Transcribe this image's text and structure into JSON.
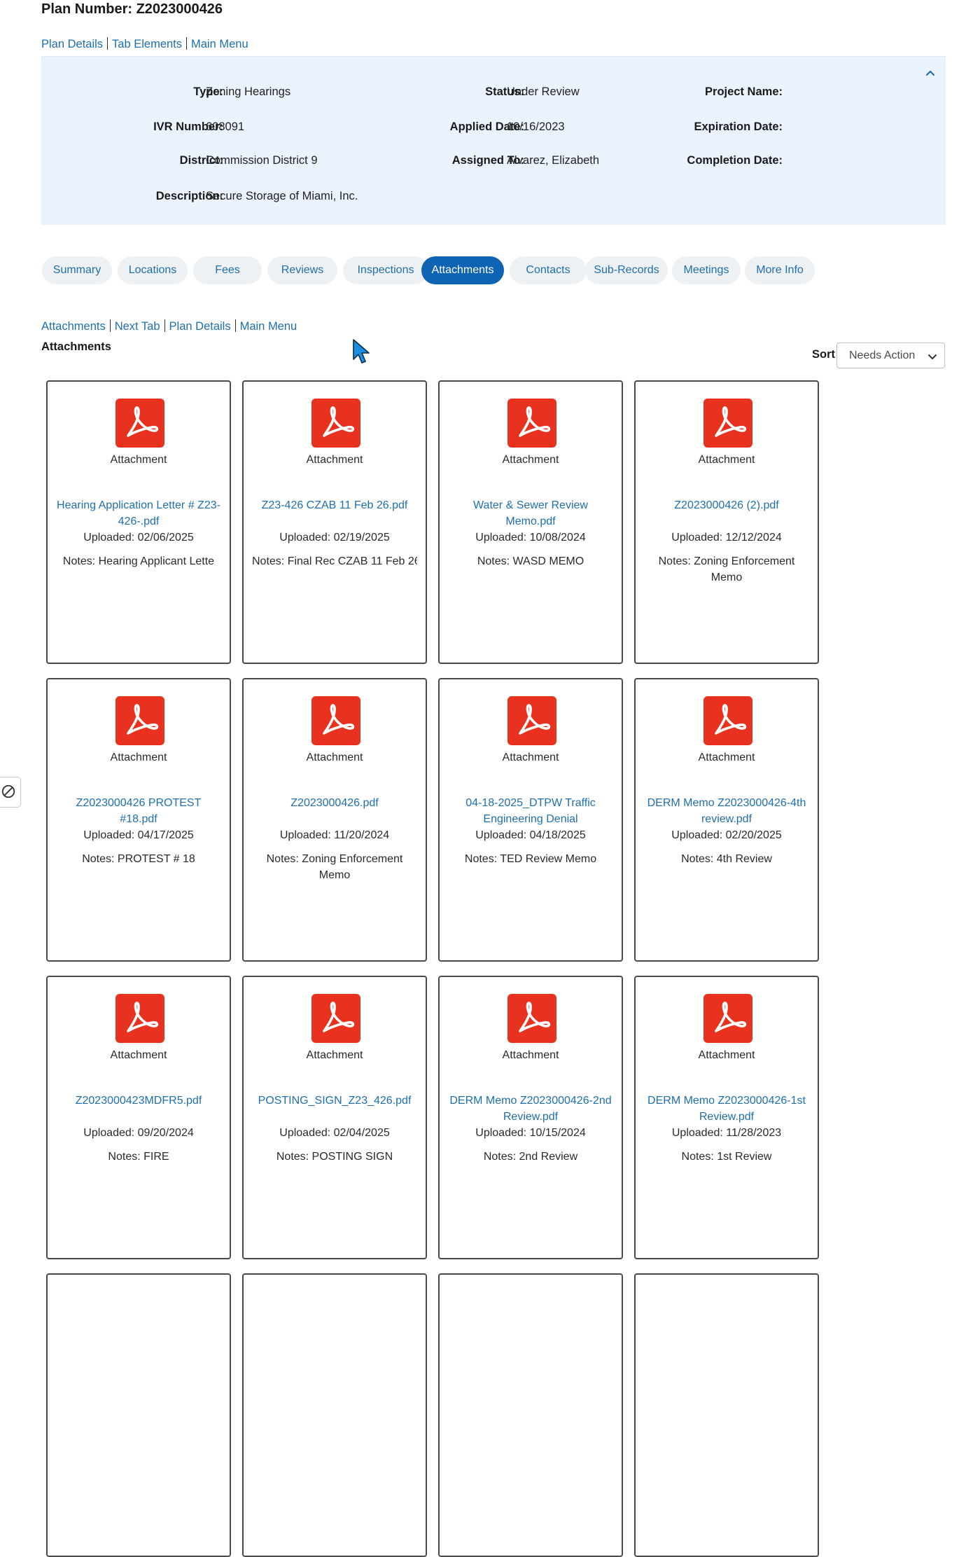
{
  "page": {
    "title": "Plan Number: Z2023000426"
  },
  "top_links": [
    "Plan Details",
    "Tab Elements",
    "Main Menu"
  ],
  "details": {
    "type_label": "Type:",
    "type_value": "Zoning Hearings",
    "ivr_label": "IVR Number:",
    "ivr_value": "608091",
    "district_label": "District:",
    "district_value": "Commission District 9",
    "description_label": "Description:",
    "description_value": "Secure Storage of Miami, Inc.",
    "status_label": "Status:",
    "status_value": "Under Review",
    "applied_label": "Applied Date:",
    "applied_value": "10/16/2023",
    "assigned_label": "Assigned To:",
    "assigned_value": "Alvarez, Elizabeth",
    "project_label": "Project Name:",
    "expiration_label": "Expiration Date:",
    "completion_label": "Completion Date:"
  },
  "tabs": [
    "Summary",
    "Locations",
    "Fees",
    "Reviews",
    "Inspections",
    "Attachments",
    "Contacts",
    "Sub-Records",
    "Meetings",
    "More Info"
  ],
  "active_tab": "Attachments",
  "attachment_links": [
    "Attachments",
    "Next Tab",
    "Plan Details",
    "Main Menu"
  ],
  "section_title": "Attachments",
  "sort": {
    "label": "Sort",
    "value": "Needs Action"
  },
  "attachments": [
    {
      "type": "Attachment",
      "file": "Hearing Application Letter # Z23-426-.pdf",
      "uploaded": "Uploaded: 02/06/2025",
      "notes": "Notes: Hearing Applicant Lette"
    },
    {
      "type": "Attachment",
      "file": "Z23-426 CZAB 11 Feb 26.pdf",
      "uploaded": "Uploaded: 02/19/2025",
      "notes": "Notes: Final Rec CZAB 11 Feb 26"
    },
    {
      "type": "Attachment",
      "file": "Water & Sewer Review Memo.pdf",
      "uploaded": "Uploaded: 10/08/2024",
      "notes": "Notes: WASD MEMO"
    },
    {
      "type": "Attachment",
      "file": "Z2023000426 (2).pdf",
      "uploaded": "Uploaded: 12/12/2024",
      "notes": "Notes: Zoning Enforcement Memo"
    },
    {
      "type": "Attachment",
      "file": "Z2023000426 PROTEST #18.pdf",
      "uploaded": "Uploaded: 04/17/2025",
      "notes": "Notes: PROTEST # 18"
    },
    {
      "type": "Attachment",
      "file": "Z2023000426.pdf",
      "uploaded": "Uploaded: 11/20/2024",
      "notes": "Notes: Zoning Enforcement Memo"
    },
    {
      "type": "Attachment",
      "file": "04-18-2025_DTPW Traffic Engineering Denial",
      "uploaded": "Uploaded: 04/18/2025",
      "notes": "Notes: TED Review Memo"
    },
    {
      "type": "Attachment",
      "file": "DERM Memo Z2023000426-4th review.pdf",
      "uploaded": "Uploaded: 02/20/2025",
      "notes": "Notes: 4th Review"
    },
    {
      "type": "Attachment",
      "file": "Z2023000423MDFR5.pdf",
      "uploaded": "Uploaded: 09/20/2024",
      "notes": "Notes: FIRE"
    },
    {
      "type": "Attachment",
      "file": "POSTING_SIGN_Z23_426.pdf",
      "uploaded": "Uploaded: 02/04/2025",
      "notes": "Notes: POSTING SIGN"
    },
    {
      "type": "Attachment",
      "file": "DERM Memo Z2023000426-2nd Review.pdf",
      "uploaded": "Uploaded: 10/15/2024",
      "notes": "Notes: 2nd Review"
    },
    {
      "type": "Attachment",
      "file": "DERM Memo Z2023000426-1st Review.pdf",
      "uploaded": "Uploaded: 11/28/2023",
      "notes": "Notes: 1st Review"
    }
  ],
  "colors": {
    "link": "#1f6fad",
    "active_tab": "#0e63b3",
    "panel_bg": "#eaf3fb",
    "pdf_red": "#e8321f"
  },
  "icons": {
    "file": "pdf-icon",
    "collapse": "chevron-up-icon",
    "sort": "chevron-down-icon",
    "side": "block-icon"
  }
}
